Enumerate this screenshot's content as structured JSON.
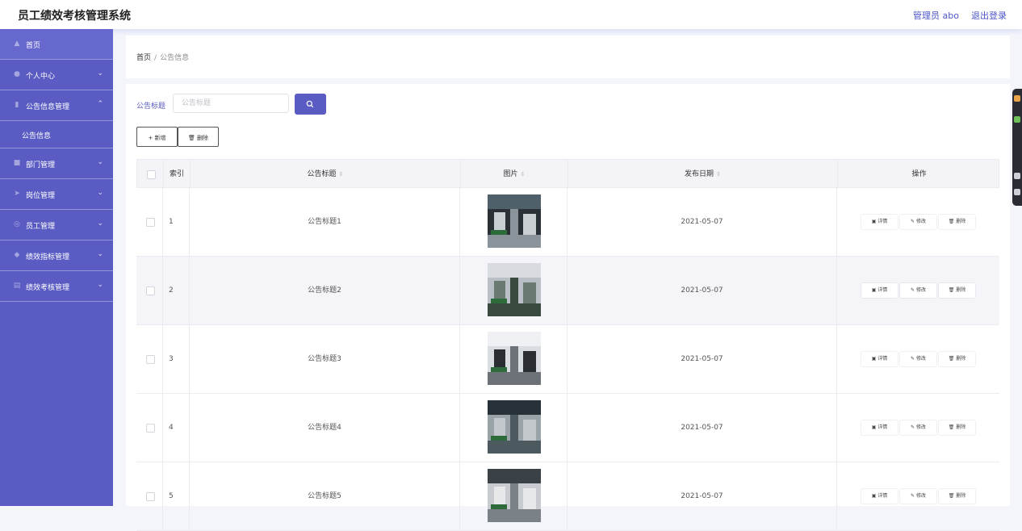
{
  "app": {
    "title": "员工绩效考核管理系统"
  },
  "header": {
    "user_label": "管理员 abo",
    "logout_label": "退出登录"
  },
  "sidebar": {
    "items": [
      {
        "label": "首页",
        "icon": "home-icon",
        "expandable": false
      },
      {
        "label": "个人中心",
        "icon": "user-icon",
        "expandable": true
      },
      {
        "label": "公告信息管理",
        "icon": "mic-icon",
        "expandable": true,
        "expanded": true
      },
      {
        "label": "部门管理",
        "icon": "building-icon",
        "expandable": true
      },
      {
        "label": "岗位管理",
        "icon": "send-icon",
        "expandable": true
      },
      {
        "label": "员工管理",
        "icon": "compass-icon",
        "expandable": true
      },
      {
        "label": "绩效指标管理",
        "icon": "location-icon",
        "expandable": true
      },
      {
        "label": "绩效考核管理",
        "icon": "document-icon",
        "expandable": true
      }
    ],
    "subitem": "公告信息"
  },
  "breadcrumb": {
    "home": "首页",
    "separator": "/",
    "current": "公告信息"
  },
  "search": {
    "label": "公告标题",
    "placeholder": "公告标题"
  },
  "toolbar": {
    "add_label": "+ 新增",
    "delete_label": "🗑 删除"
  },
  "table": {
    "columns": {
      "index": "索引",
      "title": "公告标题",
      "image": "图片",
      "date": "发布日期",
      "actions": "操作"
    },
    "rows": [
      {
        "index": "1",
        "title": "公告标题1",
        "date": "2021-05-07"
      },
      {
        "index": "2",
        "title": "公告标题2",
        "date": "2021-05-07"
      },
      {
        "index": "3",
        "title": "公告标题3",
        "date": "2021-05-07"
      },
      {
        "index": "4",
        "title": "公告标题4",
        "date": "2021-05-07"
      },
      {
        "index": "5",
        "title": "公告标题5",
        "date": "2021-05-07"
      }
    ],
    "actions": {
      "detail": "详情",
      "edit": "修改",
      "delete": "删除"
    }
  },
  "colors": {
    "accent": "#5a5cc3",
    "sidebar_bg": "#5a5cc3",
    "page_bg": "#f3f5fb"
  }
}
